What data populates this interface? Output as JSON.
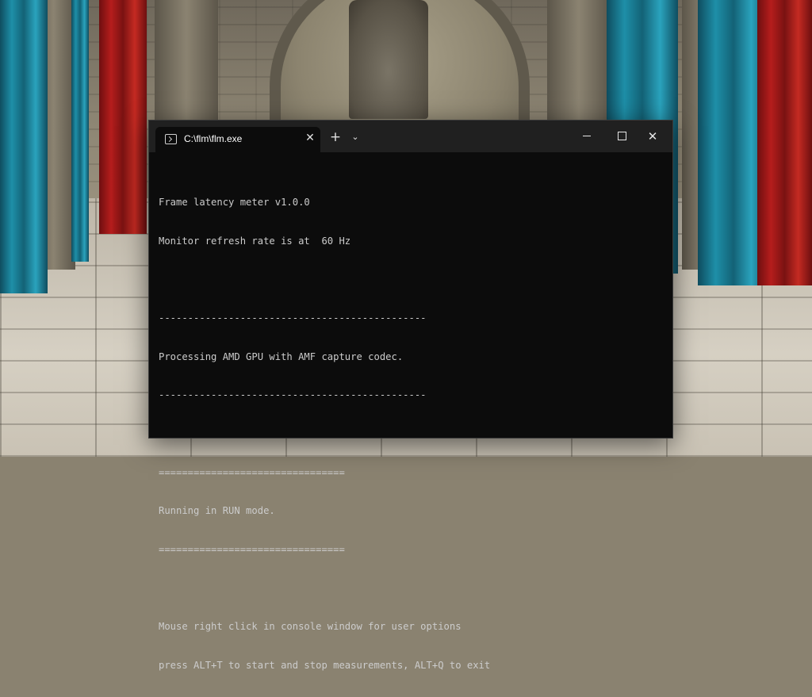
{
  "window": {
    "tab_title": "C:\\flm\\flm.exe",
    "icons": {
      "tab": "terminal-icon",
      "tab_close": "close-icon",
      "new_tab": "plus-icon",
      "dropdown": "chevron-down-icon",
      "minimize": "minimize-icon",
      "maximize": "maximize-icon",
      "close": "close-icon"
    },
    "close_glyph": "✕",
    "new_tab_glyph": "+",
    "dropdown_glyph": "⌄"
  },
  "console": {
    "lines": [
      "Frame latency meter v1.0.0",
      "Monitor refresh rate is at  60 Hz",
      "",
      "----------------------------------------------",
      "Processing AMD GPU with AMF capture codec.",
      "----------------------------------------------",
      "",
      "================================",
      "Running in RUN mode.",
      "================================",
      "",
      "Mouse right click in console window for user options",
      "press ALT+T to start and stop measurements, ALT+Q to exit"
    ]
  },
  "colors": {
    "console_bg": "#0c0c0c",
    "console_text": "#cccccc",
    "titlebar_bg": "#202020"
  }
}
